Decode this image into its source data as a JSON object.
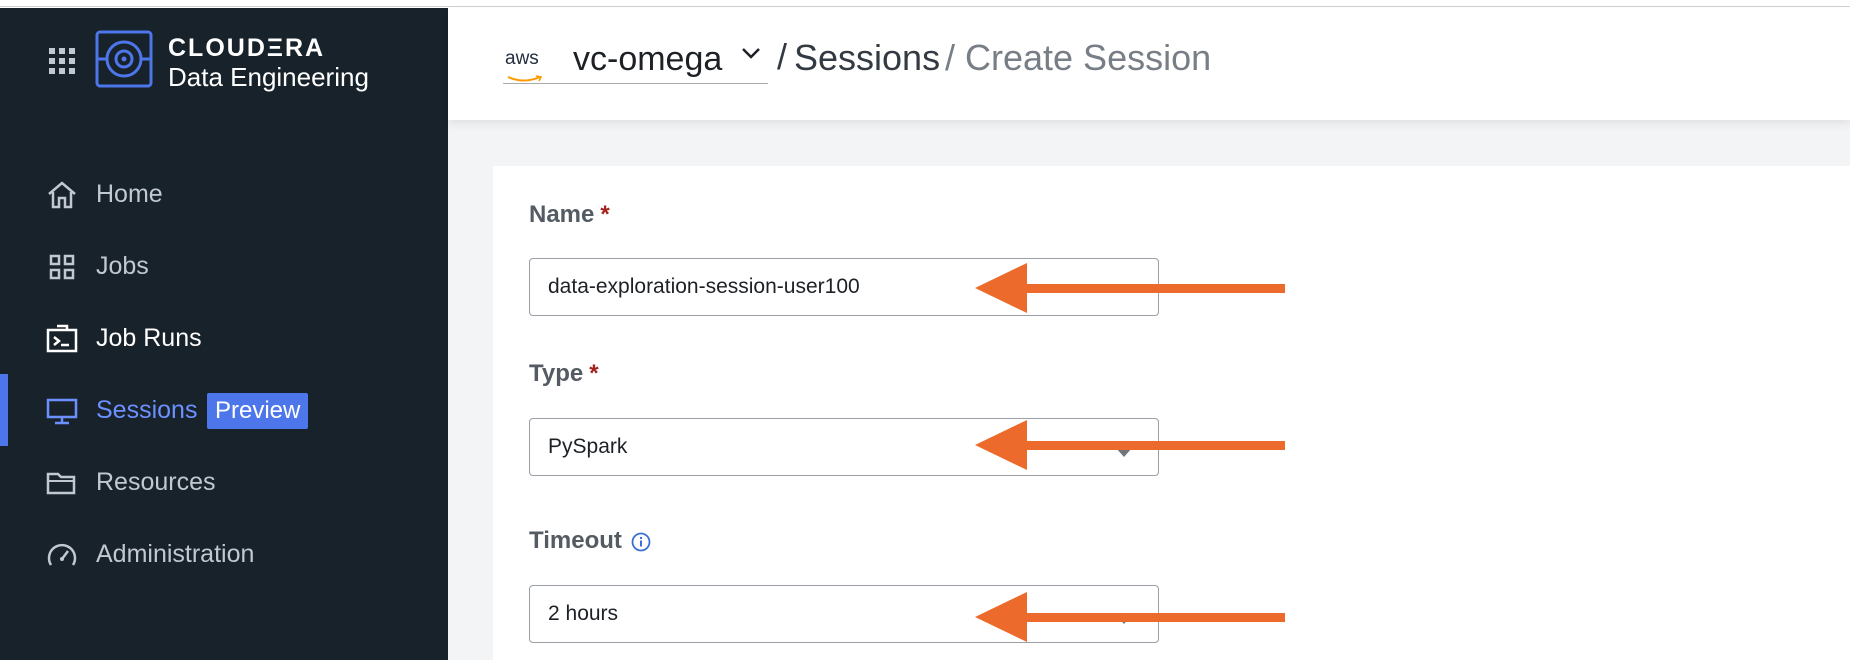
{
  "brand": {
    "name": "CLOUDΞRA",
    "product": "Data Engineering"
  },
  "nav": {
    "items": [
      {
        "label": "Home",
        "icon": "home-icon"
      },
      {
        "label": "Jobs",
        "icon": "grid-icon"
      },
      {
        "label": "Job Runs",
        "icon": "terminal-icon"
      },
      {
        "label": "Sessions",
        "icon": "monitor-icon",
        "badge": "Preview"
      },
      {
        "label": "Resources",
        "icon": "folder-icon"
      },
      {
        "label": "Administration",
        "icon": "gauge-icon"
      }
    ],
    "active": "Sessions"
  },
  "header": {
    "cloud_provider": "aws",
    "virtual_cluster": "vc-omega",
    "breadcrumb": {
      "separator": "/",
      "parent": "Sessions",
      "current": "/ Create Session"
    }
  },
  "form": {
    "name": {
      "label": "Name",
      "required_mark": "*",
      "value": "data-exploration-session-user100"
    },
    "type": {
      "label": "Type",
      "required_mark": "*",
      "value": "PySpark"
    },
    "timeout": {
      "label": "Timeout",
      "value": "2 hours"
    }
  },
  "colors": {
    "sidebar_bg": "#18222b",
    "accent": "#4d76ea",
    "annotation_arrow": "#ec6a2c",
    "required": "#a2221c"
  }
}
